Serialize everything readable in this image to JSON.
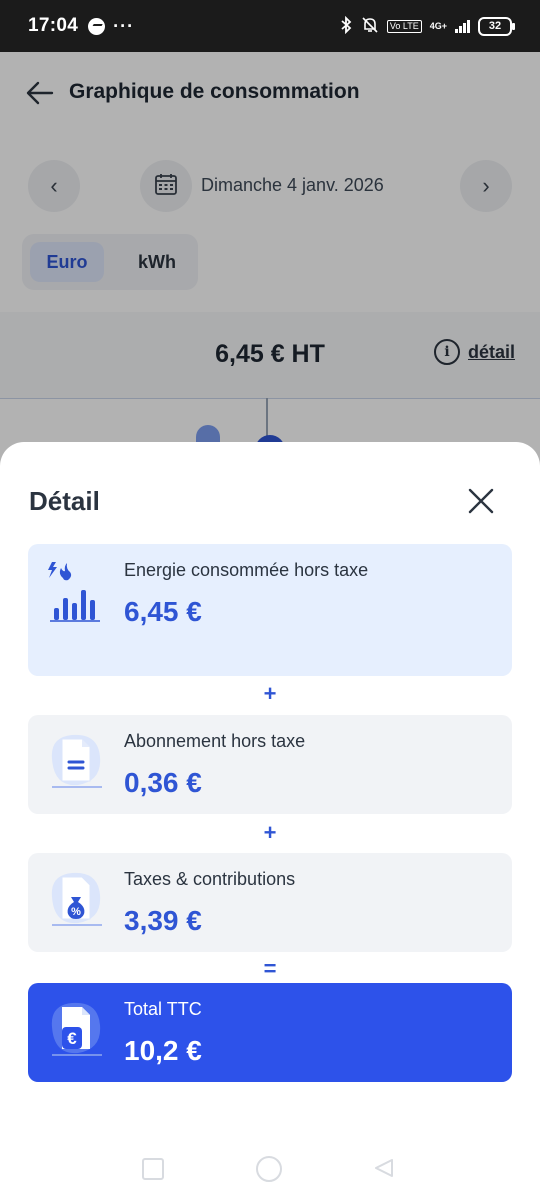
{
  "status_bar": {
    "time": "17:04",
    "dots": "···",
    "network": "4G+",
    "lte": "Vo LTE",
    "battery": "32"
  },
  "header": {
    "title": "Graphique de consommation"
  },
  "date_nav": {
    "date": "Dimanche 4 janv. 2026",
    "prev": "‹",
    "next": "›"
  },
  "unit_toggle": {
    "options": [
      "Euro",
      "kWh"
    ],
    "selected": "Euro"
  },
  "summary": {
    "amount": "6,45 € HT",
    "detail_link": "détail"
  },
  "sheet": {
    "title": "Détail",
    "items": [
      {
        "label": "Energie consommée hors taxe",
        "value": "6,45 €"
      },
      {
        "label": "Abonnement hors taxe",
        "value": "0,36 €"
      },
      {
        "label": "Taxes & contributions",
        "value": "3,39 €"
      },
      {
        "label": "Total TTC",
        "value": "10,2 €"
      }
    ],
    "operators": [
      "+",
      "+",
      "="
    ]
  },
  "colors": {
    "accent": "#2f55d4",
    "total_card": "#2d52ea",
    "energy_card": "#e6effe",
    "card": "#f1f3f6"
  }
}
